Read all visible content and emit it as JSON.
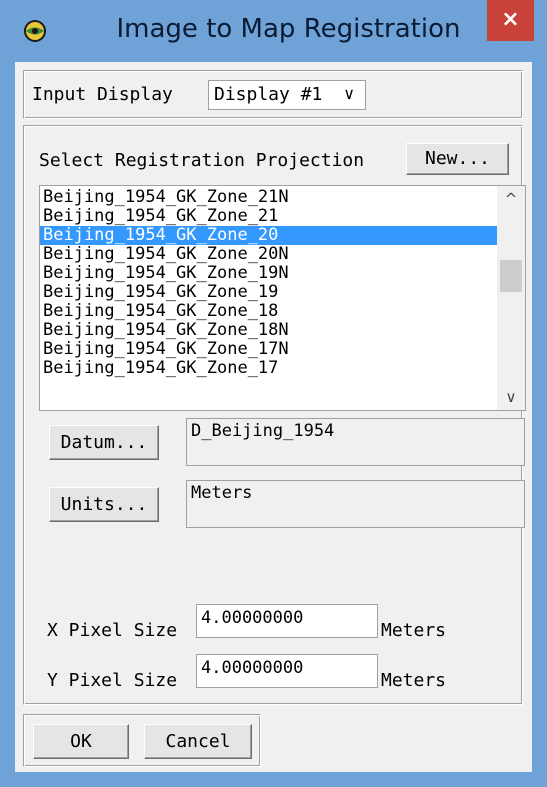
{
  "window": {
    "title": "Image to Map Registration",
    "close_label": "×",
    "titlebar_color": "#6fa3d8",
    "close_color": "#c8423a"
  },
  "input_display": {
    "label": "Input Display",
    "selected": "Display #1",
    "chevron": "∨"
  },
  "projection": {
    "label": "Select Registration Projection",
    "new_button": "New...",
    "items": [
      "Beijing_1954_GK_Zone_21N",
      "Beijing_1954_GK_Zone_21",
      "Beijing_1954_GK_Zone_20",
      "Beijing_1954_GK_Zone_20N",
      "Beijing_1954_GK_Zone_19N",
      "Beijing_1954_GK_Zone_19",
      "Beijing_1954_GK_Zone_18",
      "Beijing_1954_GK_Zone_18N",
      "Beijing_1954_GK_Zone_17N",
      "Beijing_1954_GK_Zone_17"
    ],
    "selected_index": 2,
    "selection_color": "#3399ff",
    "scroll_up": "^",
    "scroll_down": "∨"
  },
  "datum": {
    "button": "Datum...",
    "value": "D_Beijing_1954"
  },
  "units": {
    "button": "Units...",
    "value": "Meters"
  },
  "pixel_size": {
    "x_label": "X Pixel Size",
    "x_value": "4.00000000",
    "x_unit": "Meters",
    "y_label": "Y Pixel Size",
    "y_value": "4.00000000",
    "y_unit": "Meters"
  },
  "footer": {
    "ok": "OK",
    "cancel": "Cancel"
  }
}
